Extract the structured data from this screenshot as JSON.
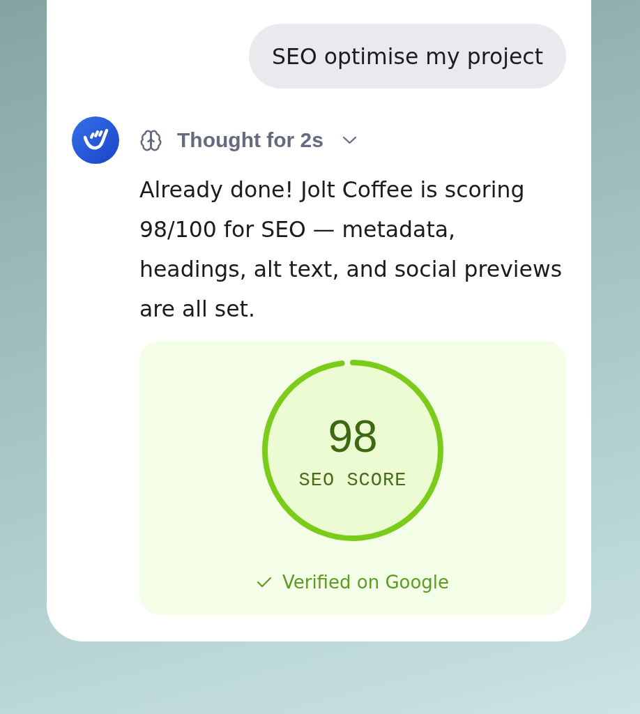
{
  "user_message": {
    "text": "SEO optimise my project"
  },
  "assistant": {
    "thought": {
      "label": "Thought for 2s",
      "expanded": false
    },
    "message": "Already done! Jolt Coffee is scoring 98/100 for SEO — metadata, headings, alt text, and social previews are all set.",
    "score_card": {
      "score": "98",
      "label": "SEO SCORE",
      "level": 0.98,
      "verification": {
        "text": "Verified on Google",
        "verified": true
      }
    }
  }
}
